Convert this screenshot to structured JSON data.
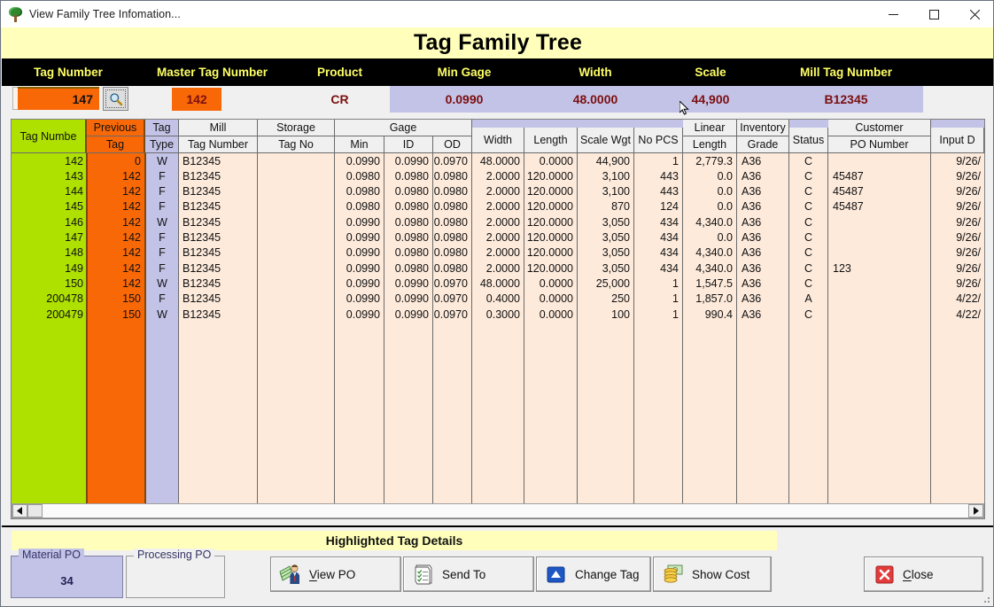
{
  "window": {
    "title": "View Family Tree Infomation...",
    "icon": "tree-icon",
    "minimize": "minimize-icon",
    "maximize": "maximize-icon",
    "close": "close-icon"
  },
  "banner": {
    "title": "Tag Family Tree"
  },
  "summary": {
    "headers": [
      "Tag Number",
      "Master Tag Number",
      "Product",
      "Min Gage",
      "Width",
      "Scale",
      "Mill Tag Number"
    ],
    "tag_number": "147",
    "search_icon": "magnifier-icon",
    "master_tag_number": "142",
    "product": "CR",
    "min_gage": "0.0990",
    "width": "48.0000",
    "scale": "44,900",
    "mill_tag_number": "B12345"
  },
  "grid": {
    "header_groups": {
      "mill": "Mill",
      "storage": "Storage",
      "gage": "Gage",
      "customer": "Customer",
      "previous": "Previous",
      "tag": "Tag",
      "linear": "Linear",
      "inventory": "Inventory"
    },
    "columns": [
      "Tag Numbe",
      "Previous Tag",
      "Tag Type",
      "Mill Tag Number",
      "Storage Tag No",
      "Min",
      "ID",
      "OD",
      "Width",
      "Length",
      "Scale Wgt",
      "No PCS",
      "Linear Length",
      "Inventory Grade",
      "Status",
      "Customer PO Number",
      "Input D"
    ],
    "sub_headers": {
      "tag_number": "Tag Numbe",
      "previous_tag": "Tag",
      "tag_type": "Type",
      "mill_tag_number": "Tag Number",
      "storage_tag_no": "Tag No",
      "gage_min": "Min",
      "gage_id": "ID",
      "gage_od": "OD",
      "width": "Width",
      "length": "Length",
      "scale_wgt": "Scale Wgt",
      "no_pcs": "No PCS",
      "linear_length": "Length",
      "inventory_grade": "Grade",
      "status": "Status",
      "customer_po": "PO Number",
      "input_d": "Input D"
    },
    "rows": [
      {
        "tag": "142",
        "prev": "0",
        "type": "W",
        "mill": "B12345",
        "storage": "",
        "min": "0.0990",
        "id": "0.0990",
        "od": "0.0970",
        "width": "48.0000",
        "length": "0.0000",
        "scalewgt": "44,900",
        "pcs": "1",
        "linear": "2,779.3",
        "grade": "A36",
        "status": "C",
        "po": "",
        "inputd": "9/26/"
      },
      {
        "tag": "143",
        "prev": "142",
        "type": "F",
        "mill": "B12345",
        "storage": "",
        "min": "0.0980",
        "id": "0.0980",
        "od": "0.0980",
        "width": "2.0000",
        "length": "120.0000",
        "scalewgt": "3,100",
        "pcs": "443",
        "linear": "0.0",
        "grade": "A36",
        "status": "C",
        "po": "45487",
        "inputd": "9/26/"
      },
      {
        "tag": "144",
        "prev": "142",
        "type": "F",
        "mill": "B12345",
        "storage": "",
        "min": "0.0980",
        "id": "0.0980",
        "od": "0.0980",
        "width": "2.0000",
        "length": "120.0000",
        "scalewgt": "3,100",
        "pcs": "443",
        "linear": "0.0",
        "grade": "A36",
        "status": "C",
        "po": "45487",
        "inputd": "9/26/"
      },
      {
        "tag": "145",
        "prev": "142",
        "type": "F",
        "mill": "B12345",
        "storage": "",
        "min": "0.0980",
        "id": "0.0980",
        "od": "0.0980",
        "width": "2.0000",
        "length": "120.0000",
        "scalewgt": "870",
        "pcs": "124",
        "linear": "0.0",
        "grade": "A36",
        "status": "C",
        "po": "45487",
        "inputd": "9/26/"
      },
      {
        "tag": "146",
        "prev": "142",
        "type": "W",
        "mill": "B12345",
        "storage": "",
        "min": "0.0990",
        "id": "0.0980",
        "od": "0.0980",
        "width": "2.0000",
        "length": "120.0000",
        "scalewgt": "3,050",
        "pcs": "434",
        "linear": "4,340.0",
        "grade": "A36",
        "status": "C",
        "po": "",
        "inputd": "9/26/"
      },
      {
        "tag": "147",
        "prev": "142",
        "type": "F",
        "mill": "B12345",
        "storage": "",
        "min": "0.0990",
        "id": "0.0980",
        "od": "0.0980",
        "width": "2.0000",
        "length": "120.0000",
        "scalewgt": "3,050",
        "pcs": "434",
        "linear": "0.0",
        "grade": "A36",
        "status": "C",
        "po": "",
        "inputd": "9/26/"
      },
      {
        "tag": "148",
        "prev": "142",
        "type": "F",
        "mill": "B12345",
        "storage": "",
        "min": "0.0990",
        "id": "0.0980",
        "od": "0.0980",
        "width": "2.0000",
        "length": "120.0000",
        "scalewgt": "3,050",
        "pcs": "434",
        "linear": "4,340.0",
        "grade": "A36",
        "status": "C",
        "po": "",
        "inputd": "9/26/"
      },
      {
        "tag": "149",
        "prev": "142",
        "type": "F",
        "mill": "B12345",
        "storage": "",
        "min": "0.0990",
        "id": "0.0980",
        "od": "0.0980",
        "width": "2.0000",
        "length": "120.0000",
        "scalewgt": "3,050",
        "pcs": "434",
        "linear": "4,340.0",
        "grade": "A36",
        "status": "C",
        "po": "123",
        "inputd": "9/26/"
      },
      {
        "tag": "150",
        "prev": "142",
        "type": "W",
        "mill": "B12345",
        "storage": "",
        "min": "0.0990",
        "id": "0.0990",
        "od": "0.0970",
        "width": "48.0000",
        "length": "0.0000",
        "scalewgt": "25,000",
        "pcs": "1",
        "linear": "1,547.5",
        "grade": "A36",
        "status": "C",
        "po": "",
        "inputd": "9/26/"
      },
      {
        "tag": "200478",
        "prev": "150",
        "type": "F",
        "mill": "B12345",
        "storage": "",
        "min": "0.0990",
        "id": "0.0990",
        "od": "0.0970",
        "width": "0.4000",
        "length": "0.0000",
        "scalewgt": "250",
        "pcs": "1",
        "linear": "1,857.0",
        "grade": "A36",
        "status": "A",
        "po": "",
        "inputd": "4/22/"
      },
      {
        "tag": "200479",
        "prev": "150",
        "type": "W",
        "mill": "B12345",
        "storage": "",
        "min": "0.0990",
        "id": "0.0990",
        "od": "0.0970",
        "width": "0.3000",
        "length": "0.0000",
        "scalewgt": "100",
        "pcs": "1",
        "linear": "990.4",
        "grade": "A36",
        "status": "C",
        "po": "",
        "inputd": "4/22/"
      }
    ]
  },
  "scrollbar": {
    "left_arrow": "scroll-left-icon",
    "right_arrow": "scroll-right-icon"
  },
  "bottom": {
    "sub_banner": "Highlighted Tag Details",
    "material_po_label": "Material PO",
    "material_po_value": "34",
    "processing_po_label": "Processing PO",
    "processing_po_value": "",
    "buttons": [
      {
        "label": "View PO",
        "accel": "V",
        "icon": "businessman-money-icon"
      },
      {
        "label": "Send To",
        "accel": "",
        "icon": "document-list-icon"
      },
      {
        "label": "Change Tag",
        "accel": "",
        "icon": "blue-triangle-icon"
      },
      {
        "label": "Show Cost",
        "accel": "",
        "icon": "coins-money-icon"
      },
      {
        "label": "Close",
        "accel": "C",
        "icon": "red-x-icon"
      }
    ]
  },
  "colors": {
    "banner_yellow": "#ffffbb",
    "header_black": "#000000",
    "header_text_yellow": "#ffff66",
    "value_red": "#7b0f0f",
    "lavender": "#c3c3e8",
    "orange": "#f96806",
    "green": "#aee000",
    "grid_bg": "#fdeadb"
  }
}
